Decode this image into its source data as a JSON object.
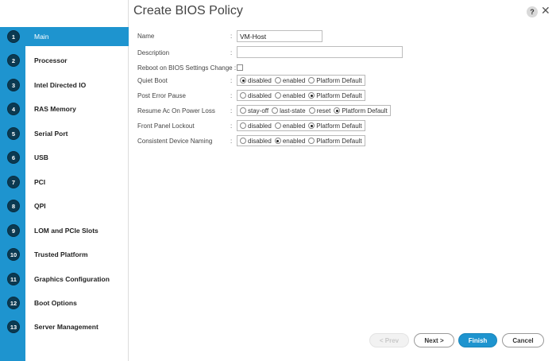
{
  "dialog": {
    "title": "Create BIOS Policy",
    "help_label": "?",
    "close_label": "✕"
  },
  "steps": [
    {
      "num": "1",
      "label": "Main",
      "active": true
    },
    {
      "num": "2",
      "label": "Processor"
    },
    {
      "num": "3",
      "label": "Intel Directed IO"
    },
    {
      "num": "4",
      "label": "RAS Memory"
    },
    {
      "num": "5",
      "label": "Serial Port"
    },
    {
      "num": "6",
      "label": "USB"
    },
    {
      "num": "7",
      "label": "PCI"
    },
    {
      "num": "8",
      "label": "QPI"
    },
    {
      "num": "9",
      "label": "LOM and PCIe Slots"
    },
    {
      "num": "10",
      "label": "Trusted Platform"
    },
    {
      "num": "11",
      "label": "Graphics Configuration"
    },
    {
      "num": "12",
      "label": "Boot Options"
    },
    {
      "num": "13",
      "label": "Server Management"
    }
  ],
  "form": {
    "name": {
      "label": "Name",
      "value": "VM-Host"
    },
    "description": {
      "label": "Description",
      "value": ""
    },
    "reboot": {
      "label": "Reboot on BIOS Settings Change :",
      "checked": false
    },
    "colon": ":",
    "quiet_boot": {
      "label": "Quiet Boot",
      "options": [
        "disabled",
        "enabled",
        "Platform Default"
      ],
      "selected": "disabled"
    },
    "post_error_pause": {
      "label": "Post Error Pause",
      "options": [
        "disabled",
        "enabled",
        "Platform Default"
      ],
      "selected": "Platform Default"
    },
    "resume_ac": {
      "label": "Resume Ac On Power Loss",
      "options": [
        "stay-off",
        "last-state",
        "reset",
        "Platform Default"
      ],
      "selected": "Platform Default"
    },
    "front_panel": {
      "label": "Front Panel Lockout",
      "options": [
        "disabled",
        "enabled",
        "Platform Default"
      ],
      "selected": "Platform Default"
    },
    "device_naming": {
      "label": "Consistent Device Naming",
      "options": [
        "disabled",
        "enabled",
        "Platform Default"
      ],
      "selected": "enabled"
    }
  },
  "footer": {
    "prev_label": "< Prev",
    "next_label": "Next >",
    "finish_label": "Finish",
    "cancel_label": "Cancel"
  },
  "colors": {
    "accent": "#1e94cf",
    "step_circle": "#0b3a52"
  }
}
